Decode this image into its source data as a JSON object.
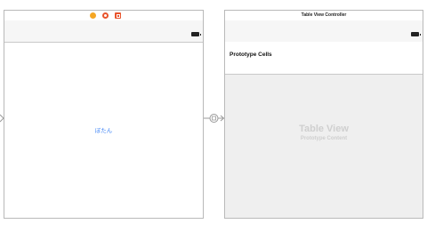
{
  "scene_left": {
    "dock_icons": [
      "view-controller-icon",
      "first-responder-icon",
      "exit-icon"
    ],
    "button_label": "ぼたん"
  },
  "scene_right": {
    "title": "Table View Controller",
    "section_title": "Prototype Cells",
    "placeholder_title": "Table View",
    "placeholder_subtitle": "Prototype Content"
  },
  "colors": {
    "accent": "#3b82f6",
    "canvas_bg": "#ffffff",
    "table_bg": "#efefef"
  }
}
